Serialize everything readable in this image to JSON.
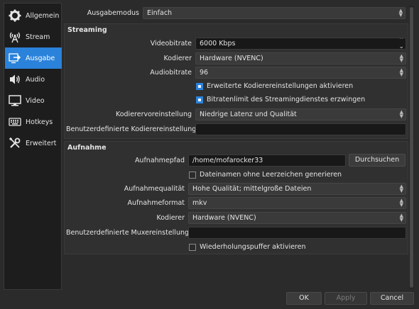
{
  "sidebar": {
    "items": [
      {
        "label": "Allgemein",
        "icon": "gear-icon"
      },
      {
        "label": "Stream",
        "icon": "antenna-icon"
      },
      {
        "label": "Ausgabe",
        "icon": "output-icon",
        "active": true
      },
      {
        "label": "Audio",
        "icon": "speaker-icon"
      },
      {
        "label": "Video",
        "icon": "monitor-icon"
      },
      {
        "label": "Hotkeys",
        "icon": "keyboard-icon"
      },
      {
        "label": "Erweitert",
        "icon": "tools-icon"
      }
    ]
  },
  "mode": {
    "label": "Ausgabemodus",
    "value": "Einfach"
  },
  "streaming": {
    "title": "Streaming",
    "video_bitrate": {
      "label": "Videobitrate",
      "value": "6000 Kbps"
    },
    "encoder": {
      "label": "Kodierer",
      "value": "Hardware (NVENC)"
    },
    "audio_bitrate": {
      "label": "Audiobitrate",
      "value": "96"
    },
    "advanced_encoder": {
      "label": "Erweiterte Kodierereinstellungen aktivieren",
      "checked": true
    },
    "enforce_limits": {
      "label": "Bitratenlimit des Streamingdienstes erzwingen",
      "checked": true
    },
    "encoder_preset": {
      "label": "Kodierervoreinstellung",
      "value": "Niedrige Latenz und Qualität"
    },
    "custom_encoder": {
      "label": "Benutzerdefinierte Kodierereinstellungen",
      "value": ""
    }
  },
  "recording": {
    "title": "Aufnahme",
    "path": {
      "label": "Aufnahmepfad",
      "value": "/home/mofarocker33"
    },
    "browse": "Durchsuchen",
    "no_spaces": {
      "label": "Dateinamen ohne Leerzeichen generieren",
      "checked": false
    },
    "quality": {
      "label": "Aufnahmequalität",
      "value": "Hohe Qualität; mittelgroße Dateien"
    },
    "format": {
      "label": "Aufnahmeformat",
      "value": "mkv"
    },
    "encoder": {
      "label": "Kodierer",
      "value": "Hardware (NVENC)"
    },
    "custom_muxer": {
      "label": "Benutzerdefinierte Muxereinstellungen",
      "value": ""
    },
    "replay_buffer": {
      "label": "Wiederholungspuffer aktivieren",
      "checked": false
    }
  },
  "buttons": {
    "ok": "OK",
    "apply": "Apply",
    "cancel": "Cancel"
  },
  "colors": {
    "accent": "#2a82da",
    "background": "#2b2b2b",
    "group": "#303030"
  }
}
